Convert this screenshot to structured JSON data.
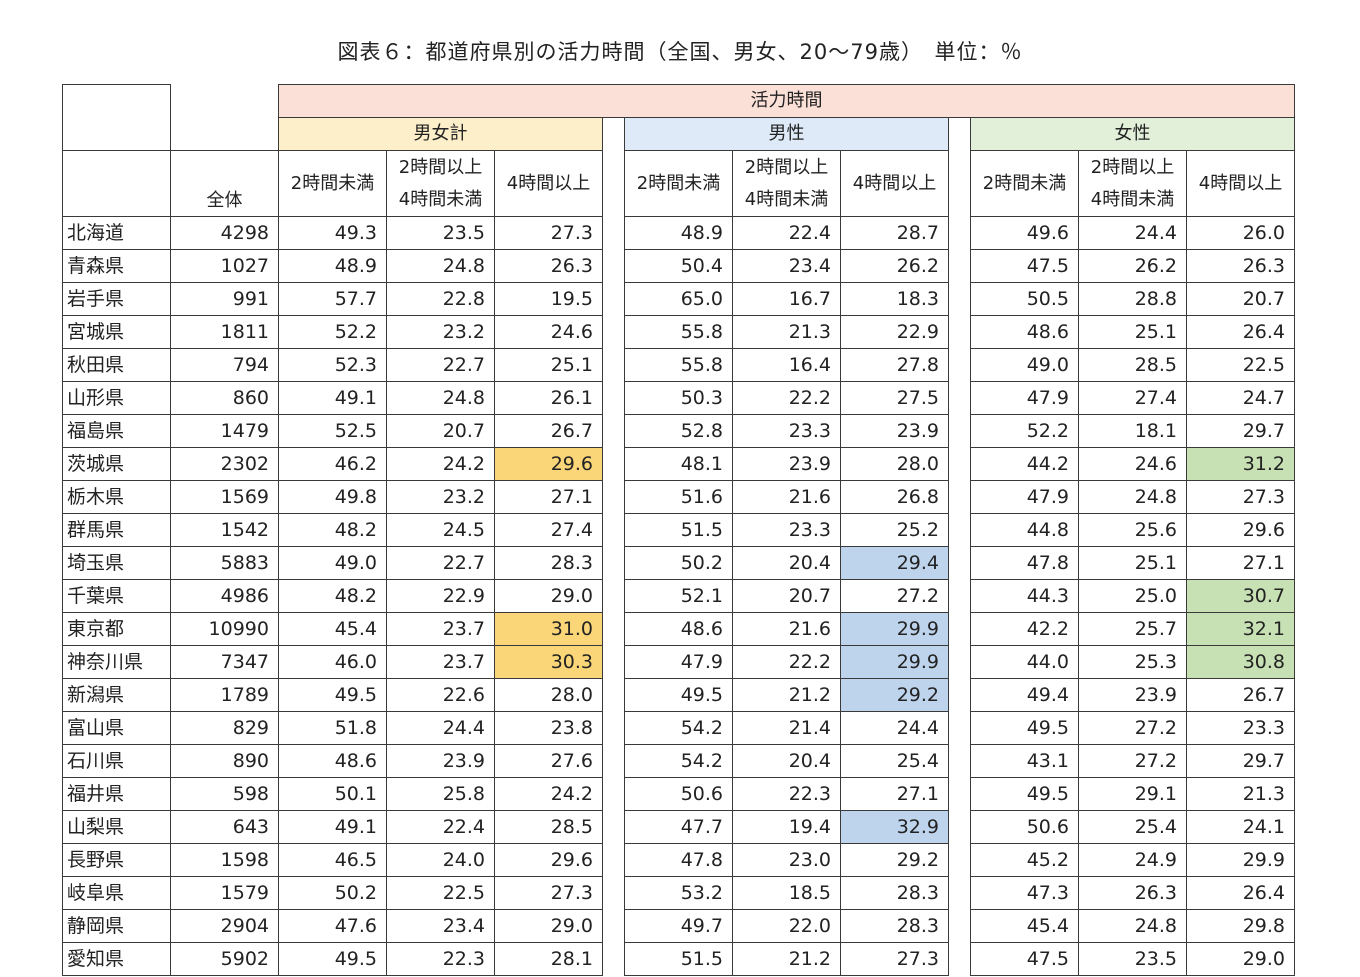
{
  "title": "図表６：都道府県別の活力時間（全国、男女、20～79歳）　単位：％",
  "header": {
    "top": "活力時間",
    "groups": [
      "男女計",
      "男性",
      "女性"
    ],
    "total": "全体",
    "col1": "2時間未満",
    "col2_line1": "2時間以上",
    "col2_line2": "4時間未満",
    "col3": "4時間以上"
  },
  "colors": {
    "header_top": "#fbe0d8",
    "all_header": "#fdefc9",
    "male_header": "#deeaf7",
    "female_header": "#e2efd9",
    "all_highlight": "#fbd678",
    "male_highlight": "#bed4ec",
    "female_highlight": "#c7e1b5"
  },
  "rows": [
    {
      "pref": "北海道",
      "total": "4298",
      "all": [
        "49.3",
        "23.5",
        "27.3"
      ],
      "male": [
        "48.9",
        "22.4",
        "28.7"
      ],
      "female": [
        "49.6",
        "24.4",
        "26.0"
      ],
      "hl": {}
    },
    {
      "pref": "青森県",
      "total": "1027",
      "all": [
        "48.9",
        "24.8",
        "26.3"
      ],
      "male": [
        "50.4",
        "23.4",
        "26.2"
      ],
      "female": [
        "47.5",
        "26.2",
        "26.3"
      ],
      "hl": {}
    },
    {
      "pref": "岩手県",
      "total": "991",
      "all": [
        "57.7",
        "22.8",
        "19.5"
      ],
      "male": [
        "65.0",
        "16.7",
        "18.3"
      ],
      "female": [
        "50.5",
        "28.8",
        "20.7"
      ],
      "hl": {}
    },
    {
      "pref": "宮城県",
      "total": "1811",
      "all": [
        "52.2",
        "23.2",
        "24.6"
      ],
      "male": [
        "55.8",
        "21.3",
        "22.9"
      ],
      "female": [
        "48.6",
        "25.1",
        "26.4"
      ],
      "hl": {}
    },
    {
      "pref": "秋田県",
      "total": "794",
      "all": [
        "52.3",
        "22.7",
        "25.1"
      ],
      "male": [
        "55.8",
        "16.4",
        "27.8"
      ],
      "female": [
        "49.0",
        "28.5",
        "22.5"
      ],
      "hl": {}
    },
    {
      "pref": "山形県",
      "total": "860",
      "all": [
        "49.1",
        "24.8",
        "26.1"
      ],
      "male": [
        "50.3",
        "22.2",
        "27.5"
      ],
      "female": [
        "47.9",
        "27.4",
        "24.7"
      ],
      "hl": {}
    },
    {
      "pref": "福島県",
      "total": "1479",
      "all": [
        "52.5",
        "20.7",
        "26.7"
      ],
      "male": [
        "52.8",
        "23.3",
        "23.9"
      ],
      "female": [
        "52.2",
        "18.1",
        "29.7"
      ],
      "hl": {}
    },
    {
      "pref": "茨城県",
      "total": "2302",
      "all": [
        "46.2",
        "24.2",
        "29.6"
      ],
      "male": [
        "48.1",
        "23.9",
        "28.0"
      ],
      "female": [
        "44.2",
        "24.6",
        "31.2"
      ],
      "hl": {
        "all": true,
        "female": true
      }
    },
    {
      "pref": "栃木県",
      "total": "1569",
      "all": [
        "49.8",
        "23.2",
        "27.1"
      ],
      "male": [
        "51.6",
        "21.6",
        "26.8"
      ],
      "female": [
        "47.9",
        "24.8",
        "27.3"
      ],
      "hl": {}
    },
    {
      "pref": "群馬県",
      "total": "1542",
      "all": [
        "48.2",
        "24.5",
        "27.4"
      ],
      "male": [
        "51.5",
        "23.3",
        "25.2"
      ],
      "female": [
        "44.8",
        "25.6",
        "29.6"
      ],
      "hl": {}
    },
    {
      "pref": "埼玉県",
      "total": "5883",
      "all": [
        "49.0",
        "22.7",
        "28.3"
      ],
      "male": [
        "50.2",
        "20.4",
        "29.4"
      ],
      "female": [
        "47.8",
        "25.1",
        "27.1"
      ],
      "hl": {
        "male": true
      }
    },
    {
      "pref": "千葉県",
      "total": "4986",
      "all": [
        "48.2",
        "22.9",
        "29.0"
      ],
      "male": [
        "52.1",
        "20.7",
        "27.2"
      ],
      "female": [
        "44.3",
        "25.0",
        "30.7"
      ],
      "hl": {
        "female": true
      }
    },
    {
      "pref": "東京都",
      "total": "10990",
      "all": [
        "45.4",
        "23.7",
        "31.0"
      ],
      "male": [
        "48.6",
        "21.6",
        "29.9"
      ],
      "female": [
        "42.2",
        "25.7",
        "32.1"
      ],
      "hl": {
        "all": true,
        "male": true,
        "female": true
      }
    },
    {
      "pref": "神奈川県",
      "total": "7347",
      "all": [
        "46.0",
        "23.7",
        "30.3"
      ],
      "male": [
        "47.9",
        "22.2",
        "29.9"
      ],
      "female": [
        "44.0",
        "25.3",
        "30.8"
      ],
      "hl": {
        "all": true,
        "male": true,
        "female": true
      }
    },
    {
      "pref": "新潟県",
      "total": "1789",
      "all": [
        "49.5",
        "22.6",
        "28.0"
      ],
      "male": [
        "49.5",
        "21.2",
        "29.2"
      ],
      "female": [
        "49.4",
        "23.9",
        "26.7"
      ],
      "hl": {
        "male": true
      }
    },
    {
      "pref": "富山県",
      "total": "829",
      "all": [
        "51.8",
        "24.4",
        "23.8"
      ],
      "male": [
        "54.2",
        "21.4",
        "24.4"
      ],
      "female": [
        "49.5",
        "27.2",
        "23.3"
      ],
      "hl": {}
    },
    {
      "pref": "石川県",
      "total": "890",
      "all": [
        "48.6",
        "23.9",
        "27.6"
      ],
      "male": [
        "54.2",
        "20.4",
        "25.4"
      ],
      "female": [
        "43.1",
        "27.2",
        "29.7"
      ],
      "hl": {}
    },
    {
      "pref": "福井県",
      "total": "598",
      "all": [
        "50.1",
        "25.8",
        "24.2"
      ],
      "male": [
        "50.6",
        "22.3",
        "27.1"
      ],
      "female": [
        "49.5",
        "29.1",
        "21.3"
      ],
      "hl": {}
    },
    {
      "pref": "山梨県",
      "total": "643",
      "all": [
        "49.1",
        "22.4",
        "28.5"
      ],
      "male": [
        "47.7",
        "19.4",
        "32.9"
      ],
      "female": [
        "50.6",
        "25.4",
        "24.1"
      ],
      "hl": {
        "male": true
      }
    },
    {
      "pref": "長野県",
      "total": "1598",
      "all": [
        "46.5",
        "24.0",
        "29.6"
      ],
      "male": [
        "47.8",
        "23.0",
        "29.2"
      ],
      "female": [
        "45.2",
        "24.9",
        "29.9"
      ],
      "hl": {}
    },
    {
      "pref": "岐阜県",
      "total": "1579",
      "all": [
        "50.2",
        "22.5",
        "27.3"
      ],
      "male": [
        "53.2",
        "18.5",
        "28.3"
      ],
      "female": [
        "47.3",
        "26.3",
        "26.4"
      ],
      "hl": {}
    },
    {
      "pref": "静岡県",
      "total": "2904",
      "all": [
        "47.6",
        "23.4",
        "29.0"
      ],
      "male": [
        "49.7",
        "22.0",
        "28.3"
      ],
      "female": [
        "45.4",
        "24.8",
        "29.8"
      ],
      "hl": {}
    },
    {
      "pref": "愛知県",
      "total": "5902",
      "all": [
        "49.5",
        "22.3",
        "28.1"
      ],
      "male": [
        "51.5",
        "21.2",
        "27.3"
      ],
      "female": [
        "47.5",
        "23.5",
        "29.0"
      ],
      "hl": {}
    }
  ]
}
